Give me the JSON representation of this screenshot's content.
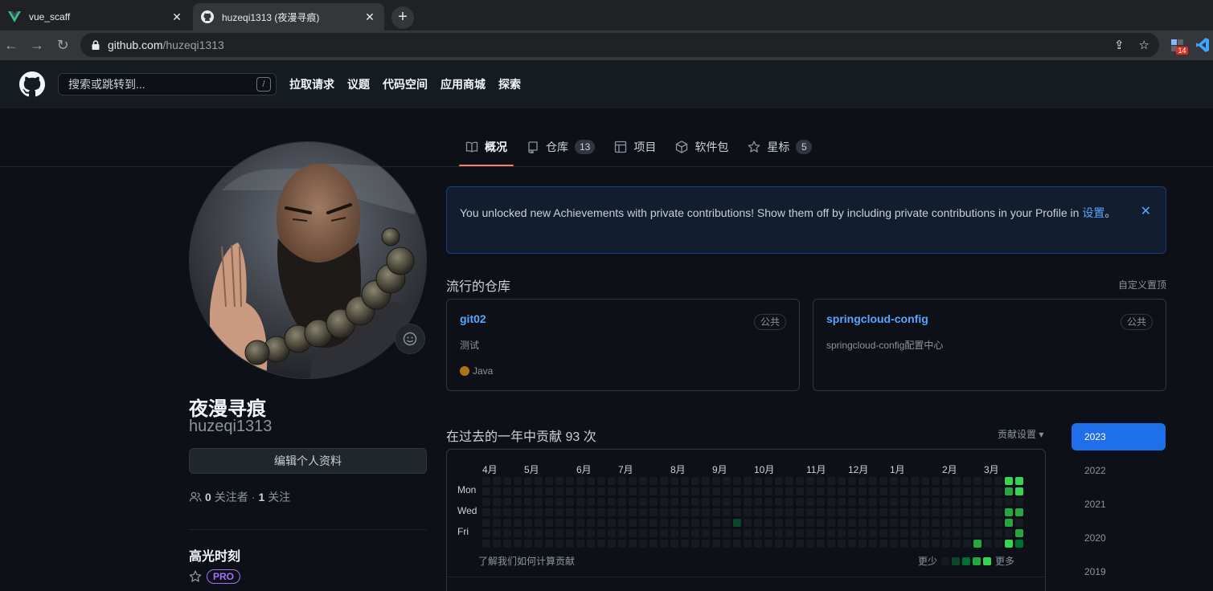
{
  "browser": {
    "tabs": [
      {
        "label": "vue_scaff",
        "icon": "vue-icon",
        "active": false
      },
      {
        "label": "huzeqi1313 (夜漫寻痕)",
        "icon": "github-icon",
        "active": true
      }
    ],
    "url_host": "github.com",
    "url_path": "/huzeqi1313",
    "extension_badge": "14"
  },
  "header": {
    "search_placeholder": "搜索或跳转到...",
    "search_shortcut": "/",
    "nav": [
      "拉取请求",
      "议题",
      "代码空间",
      "应用商城",
      "探索"
    ]
  },
  "profile_tabs": [
    {
      "label": "概况",
      "icon": "book-icon",
      "active": true,
      "count": ""
    },
    {
      "label": "仓库",
      "icon": "repo-icon",
      "active": false,
      "count": "13"
    },
    {
      "label": "项目",
      "icon": "table-icon",
      "active": false,
      "count": ""
    },
    {
      "label": "软件包",
      "icon": "package-icon",
      "active": false,
      "count": ""
    },
    {
      "label": "星标",
      "icon": "star-icon",
      "active": false,
      "count": "5"
    }
  ],
  "profile": {
    "name": "夜漫寻痕",
    "login": "huzeqi1313",
    "edit_label": "编辑个人资料",
    "followers": "0",
    "followers_label": "关注者",
    "separator": "·",
    "following": "1",
    "following_label": "关注",
    "highlights_title": "高光时刻",
    "pro_badge": "PRO"
  },
  "flash": {
    "text": "You unlocked new Achievements with private contributions! Show them off by including private contributions in your Profile in ",
    "link": "设置",
    "end": "。"
  },
  "popular": {
    "title": "流行的仓库",
    "customize": "自定义置顶",
    "repos": [
      {
        "name": "git02",
        "visibility": "公共",
        "description": "测试",
        "language": "Java",
        "lang_color": "#b07219"
      },
      {
        "name": "springcloud-config",
        "visibility": "公共",
        "description": "springcloud-config配置中心",
        "language": "",
        "lang_color": ""
      }
    ]
  },
  "contributions": {
    "title": "在过去的一年中贡献 93 次",
    "settings": "贡献设置 ▾",
    "months": [
      "4月",
      "5月",
      "6月",
      "7月",
      "8月",
      "9月",
      "10月",
      "11月",
      "12月",
      "1月",
      "2月",
      "3月"
    ],
    "days": [
      "Mon",
      "Wed",
      "Fri"
    ],
    "learn_more": "了解我们如何计算贡献",
    "less": "更少",
    "more": "更多",
    "level_colors": [
      "#161b22",
      "#0e4429",
      "#006d32",
      "#26a641",
      "#39d353"
    ]
  },
  "years": [
    "2023",
    "2022",
    "2021",
    "2020",
    "2019"
  ],
  "active_year": "2023"
}
